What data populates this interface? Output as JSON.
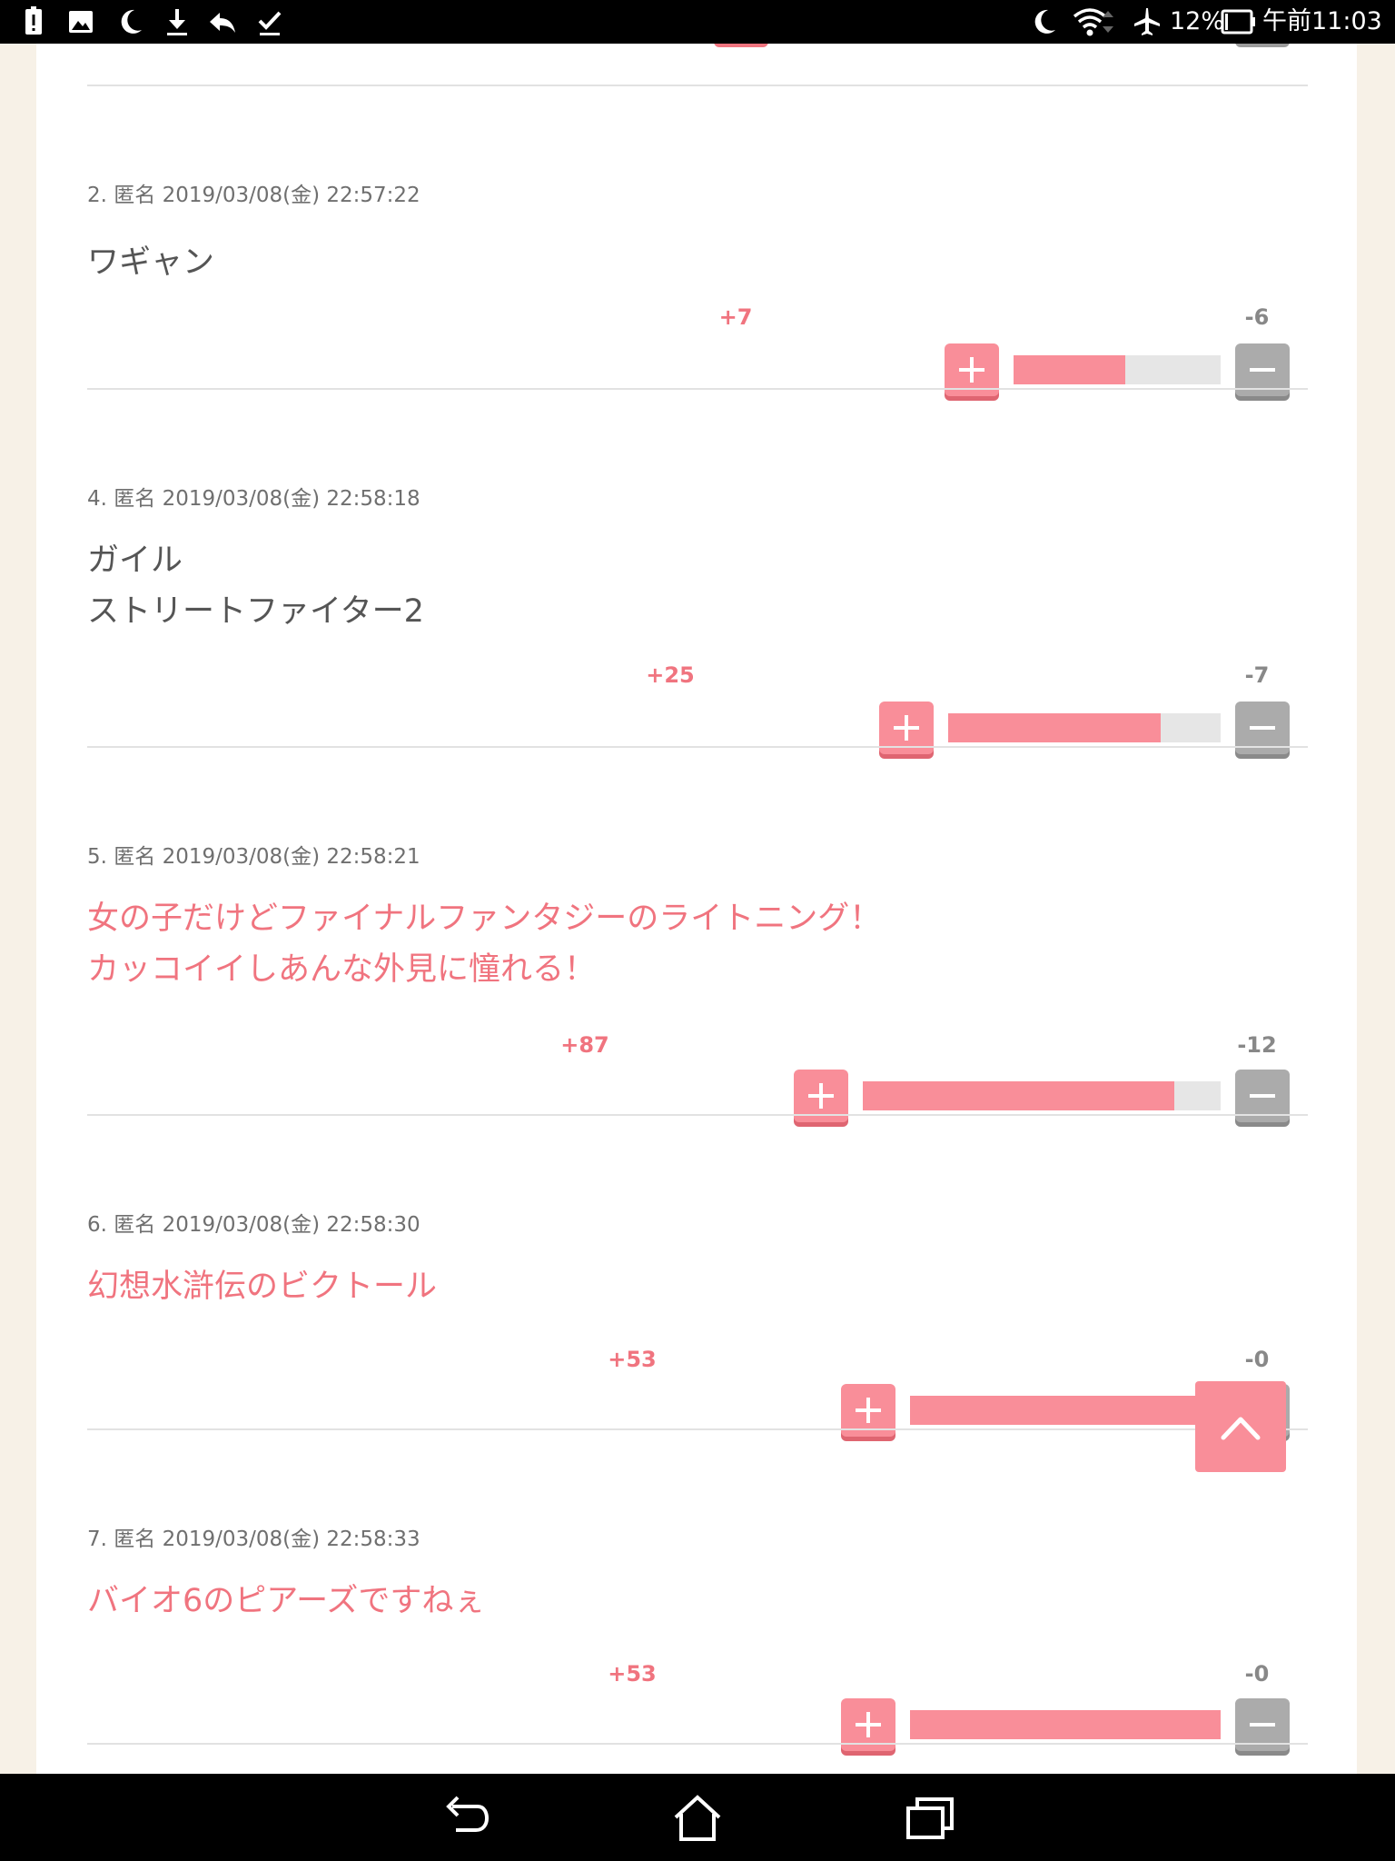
{
  "status_bar": {
    "battery_percent": "12%",
    "time": "午前11:03",
    "left_icons": [
      "alert-icon",
      "image-icon",
      "moon-icon",
      "download-icon",
      "reply-icon",
      "check-icon"
    ],
    "right_icons": [
      "moon-icon",
      "wifi-icon",
      "airplane-icon",
      "battery-icon"
    ]
  },
  "comments": [
    {
      "meta": "2. 匿名 2019/03/08(金) 22:57:22",
      "lines": [
        "ワギャン"
      ],
      "highlighted": false,
      "plus": "+7",
      "minus": "-6",
      "plus_ratio": 0.54
    },
    {
      "meta": "4. 匿名 2019/03/08(金) 22:58:18",
      "lines": [
        "ガイル",
        "ストリートファイター2"
      ],
      "highlighted": false,
      "plus": "+25",
      "minus": "-7",
      "plus_ratio": 0.78
    },
    {
      "meta": "5. 匿名 2019/03/08(金) 22:58:21",
      "lines": [
        "女の子だけどファイナルファンタジーのライトニング！",
        "カッコイイしあんな外見に憧れる！"
      ],
      "highlighted": true,
      "plus": "+87",
      "minus": "-12",
      "plus_ratio": 0.87
    },
    {
      "meta": "6. 匿名 2019/03/08(金) 22:58:30",
      "lines": [
        "幻想水滸伝のビクトール"
      ],
      "highlighted": true,
      "plus": "+53",
      "minus": "-0",
      "plus_ratio": 1.0
    },
    {
      "meta": "7. 匿名 2019/03/08(金) 22:58:33",
      "lines": [
        "バイオ6のピアーズですねぇ"
      ],
      "highlighted": true,
      "plus": "+53",
      "minus": "-0",
      "plus_ratio": 1.0
    }
  ],
  "colors": {
    "accent": "#f98e99",
    "accent_text": "#f0747f",
    "neutral_button": "#ababab",
    "page_bg": "#f7f1e7"
  },
  "icons": {
    "plus_button": "plus-icon",
    "minus_button": "minus-icon",
    "scroll_top": "chevron-up-icon",
    "nav": [
      "back-icon",
      "home-icon",
      "recents-icon"
    ]
  }
}
